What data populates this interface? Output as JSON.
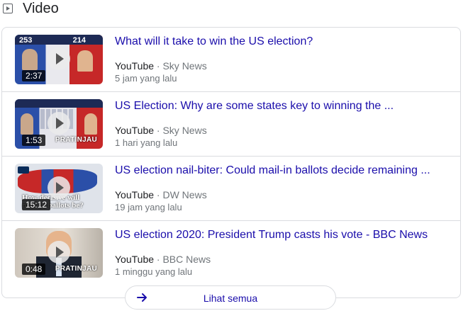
{
  "section": {
    "title": "Video",
    "icon": "video-play-icon"
  },
  "videos": [
    {
      "title": "What will it take to win the US election?",
      "platform": "YouTube",
      "separator": "·",
      "channel": "Sky News",
      "time_ago": "5 jam yang lalu",
      "duration": "2:37",
      "thumbnail_scoreboard": [
        "253",
        "214"
      ],
      "thumbnail_overlay": ""
    },
    {
      "title": "US Election: Why are some states key to winning the ...",
      "platform": "YouTube",
      "separator": "·",
      "channel": "Sky News",
      "time_ago": "1 hari yang lalu",
      "duration": "1:53",
      "thumbnail_overlay": "PRATINJAU"
    },
    {
      "title": "US election nail-biter: Could mail-in ballots decide remaining ...",
      "platform": "YouTube",
      "separator": "·",
      "channel": "DW News",
      "time_ago": "19 jam yang lalu",
      "duration": "15:12",
      "thumbnail_text": "How decisive will mail-in ballots be?",
      "thumbnail_overlay": ""
    },
    {
      "title": "US election 2020: President Trump casts his vote - BBC News",
      "platform": "YouTube",
      "separator": "·",
      "channel": "BBC News",
      "time_ago": "1 minggu yang lalu",
      "duration": "0:48",
      "thumbnail_overlay": "PRATINJAU"
    }
  ],
  "see_all": {
    "label": "Lihat semua",
    "icon": "arrow-right-icon"
  },
  "colors": {
    "link": "#1a0dab",
    "meta": "#70757a",
    "border": "#dadce0"
  }
}
